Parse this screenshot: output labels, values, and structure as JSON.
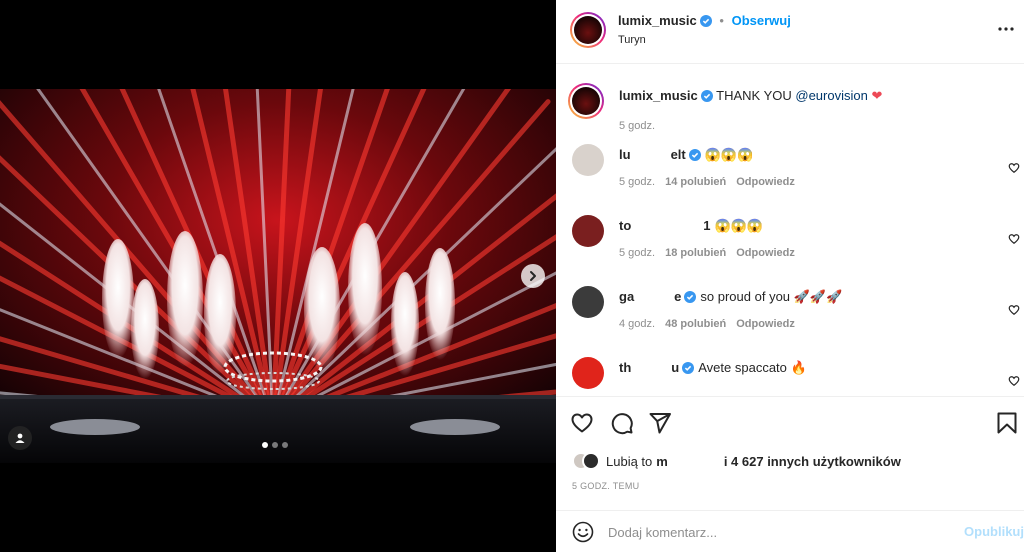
{
  "media": {
    "carousel_total": 3,
    "carousel_index": 1,
    "next_icon": "chevron-right-icon",
    "tag_icon": "user-tag-icon"
  },
  "header": {
    "username": "lumix_music",
    "separator": "•",
    "follow_label": "Obserwuj",
    "location": "Turyn",
    "more_icon": "more-horizontal-icon"
  },
  "caption": {
    "username": "lumix_music",
    "text": "THANK YOU ",
    "mention": "@eurovision",
    "emoji": "❤",
    "time": "5 godz."
  },
  "comments": [
    {
      "username": "lu",
      "username_end": "elt",
      "verified": true,
      "text": "😱😱😱",
      "time": "5 godz.",
      "likes": "14 polubień",
      "reply_label": "Odpowiedz",
      "avatar_color": "#d9d2cc"
    },
    {
      "username": "to",
      "username_end": "1",
      "verified": false,
      "text": "😱😱😱",
      "time": "5 godz.",
      "likes": "18 polubień",
      "reply_label": "Odpowiedz",
      "avatar_color": "#7a1f1f"
    },
    {
      "username": "ga",
      "username_end": "e",
      "verified": true,
      "text": "so proud of you 🚀🚀🚀",
      "time": "4 godz.",
      "likes": "48 polubień",
      "reply_label": "Odpowiedz",
      "avatar_color": "#3b3b3b"
    },
    {
      "username": "th",
      "username_end": "u",
      "verified": true,
      "text": "Avete spaccato 🔥",
      "time": "",
      "likes": "",
      "reply_label": "",
      "avatar_color": "#e0241b"
    }
  ],
  "actions": {
    "like_icon": "heart-icon",
    "comment_icon": "comment-icon",
    "share_icon": "send-icon",
    "save_icon": "bookmark-icon"
  },
  "likes": {
    "prefix": "Lubią to",
    "name_fragment": "m",
    "suffix": "i 4 627 innych użytkowników"
  },
  "post_time": "5 GODZ. TEMU",
  "add_comment": {
    "placeholder": "Dodaj komentarz...",
    "publish_label": "Opublikuj",
    "emoji_icon": "smiley-icon"
  },
  "colors": {
    "accent": "#0095f6",
    "verified": "#3897f0",
    "publish_disabled": "#b2dffc",
    "heart_red": "#ed4956"
  }
}
